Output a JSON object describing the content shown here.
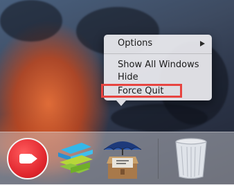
{
  "context_menu": {
    "options_label": "Options",
    "show_all_windows_label": "Show All Windows",
    "hide_label": "Hide",
    "force_quit_label": "Force Quit"
  },
  "dock": {
    "apps": [
      {
        "icon": "facetime-icon"
      },
      {
        "icon": "swift-app-icon"
      },
      {
        "icon": "archive-box-umbrella-icon"
      },
      {
        "icon": "trash-icon"
      }
    ]
  },
  "colors": {
    "highlight_border": "#e74440",
    "menu_background": "#ececf0"
  }
}
